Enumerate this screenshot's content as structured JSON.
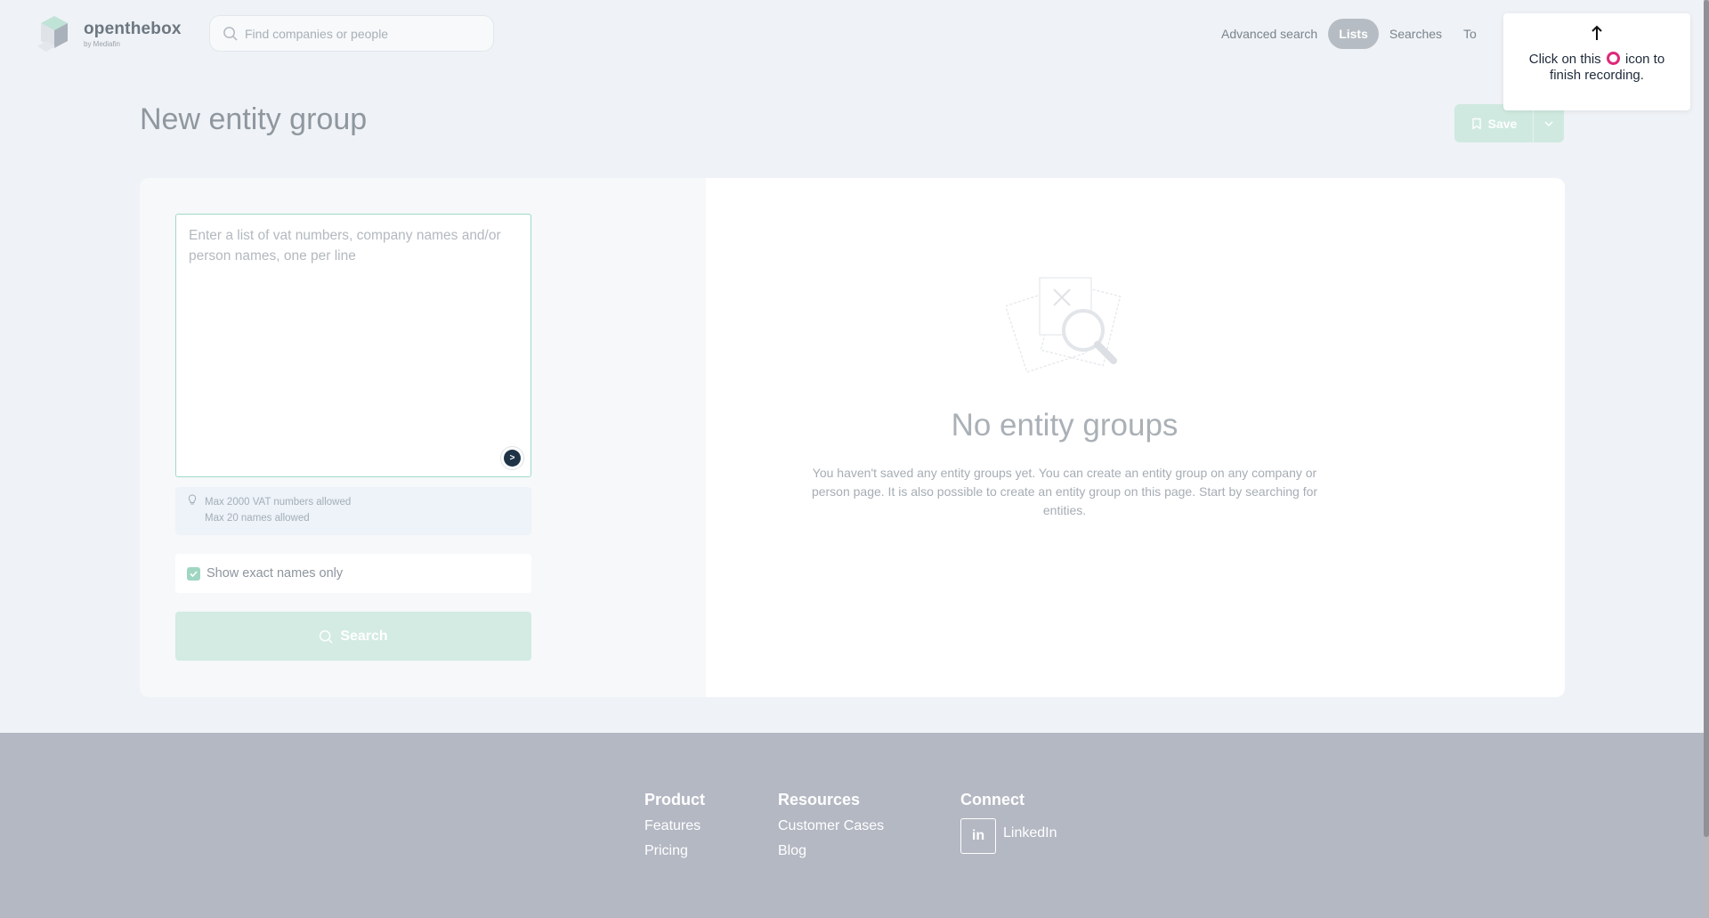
{
  "header": {
    "logo_name": "openthebox",
    "logo_sub": "by Mediafin",
    "search_placeholder": "Find companies or people",
    "nav": [
      {
        "label": "Advanced search",
        "active": false
      },
      {
        "label": "Lists",
        "active": true
      },
      {
        "label": "Searches",
        "active": false
      },
      {
        "label": "To",
        "active": false
      }
    ]
  },
  "page": {
    "title": "New entity group",
    "save_label": "Save"
  },
  "form": {
    "textarea_placeholder": "Enter a list of vat numbers, company names and/or person names, one per line",
    "textarea_value": "",
    "info_line_1": "Max 2000 VAT numbers allowed",
    "info_line_2": "Max 20 names allowed",
    "exact_names_label": "Show exact names only",
    "exact_names_checked": true,
    "search_label": "Search"
  },
  "empty_state": {
    "title": "No entity groups",
    "description": "You haven't saved any entity groups yet. You can create an entity group on any company or person page. It is also possible to create an entity group on this page. Start by searching for entities."
  },
  "footer": {
    "product": {
      "heading": "Product",
      "links": [
        "Features",
        "Pricing"
      ]
    },
    "resources": {
      "heading": "Resources",
      "links": [
        "Customer Cases",
        "Blog"
      ]
    },
    "connect": {
      "heading": "Connect",
      "linkedin": "LinkedIn",
      "linkedin_glyph": "in"
    }
  },
  "tooltip": {
    "arrow": "↑",
    "text_before": "Click on this",
    "text_after": "icon to finish recording."
  },
  "colors": {
    "accent_teal": "#9fdcc7",
    "button_teal": "#d3ebe2",
    "nav_active": "#b6bcc3",
    "footer_bg": "#b4b8c3",
    "record_icon": "#e0287a"
  },
  "icons": {
    "logo": "openthebox-cube-logo",
    "search": "search-icon",
    "save": "bookmark-icon",
    "dropdown": "chevron-down-icon",
    "tip": "lightbulb-icon",
    "empty": "magnifier-empty-icon",
    "linkedin": "linkedin-icon",
    "record": "record-icon"
  }
}
